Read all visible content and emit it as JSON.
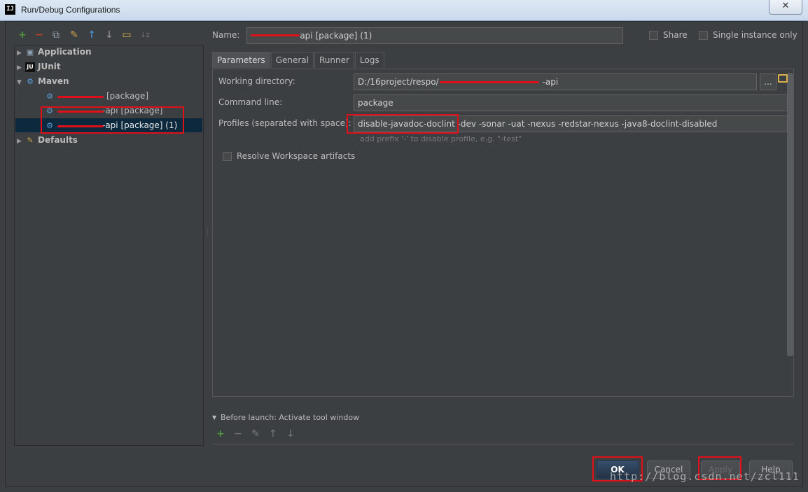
{
  "window": {
    "title": "Run/Debug Configurations",
    "app_icon": "IJ",
    "close_glyph": "✕"
  },
  "toolbar": {
    "add": "+",
    "remove": "−",
    "copy": "⧉",
    "edit_defaults": "✎",
    "move_up": "↑",
    "move_down": "↓",
    "folder": "▭",
    "sort": "↓z"
  },
  "tree": {
    "application": "Application",
    "junit": "JUnit",
    "maven": "Maven",
    "maven_children": [
      "[package]",
      "-api [package]",
      "-api [package] (1)"
    ],
    "defaults": "Defaults"
  },
  "name_label": "Name:",
  "name_value": "-api [package] (1)",
  "share_label": "Share",
  "single_instance_label": "Single instance only",
  "tabs": [
    "Parameters",
    "General",
    "Runner",
    "Logs"
  ],
  "params": {
    "working_dir_label": "Working directory:",
    "working_dir_value": "D:/16project/respo/",
    "working_dir_suffix": "-api",
    "browse_label": "...",
    "command_label": "Command line:",
    "command_value": "package",
    "profiles_label": "Profiles (separated with space):",
    "profiles_value": "disable-javadoc-doclint -dev -sonar -uat -nexus -redstar-nexus -java8-doclint-disabled",
    "profiles_hint": "add prefix '-' to disable profile, e.g. \"-test\"",
    "resolve_label": "Resolve Workspace artifacts"
  },
  "before_launch": {
    "label": "Before launch: Activate tool window",
    "add": "+",
    "remove": "−",
    "edit": "✎",
    "up": "↑",
    "down": "↓"
  },
  "buttons": {
    "ok": "OK",
    "cancel": "Cancel",
    "apply": "Apply",
    "help": "Help"
  },
  "watermark": "http://blog.csdn.net/zcl111",
  "colors": {
    "accent_green": "#4e9a3f",
    "accent_red": "#c7392b",
    "accent_blue": "#4a88c7",
    "annotation_red": "#e0101a"
  }
}
